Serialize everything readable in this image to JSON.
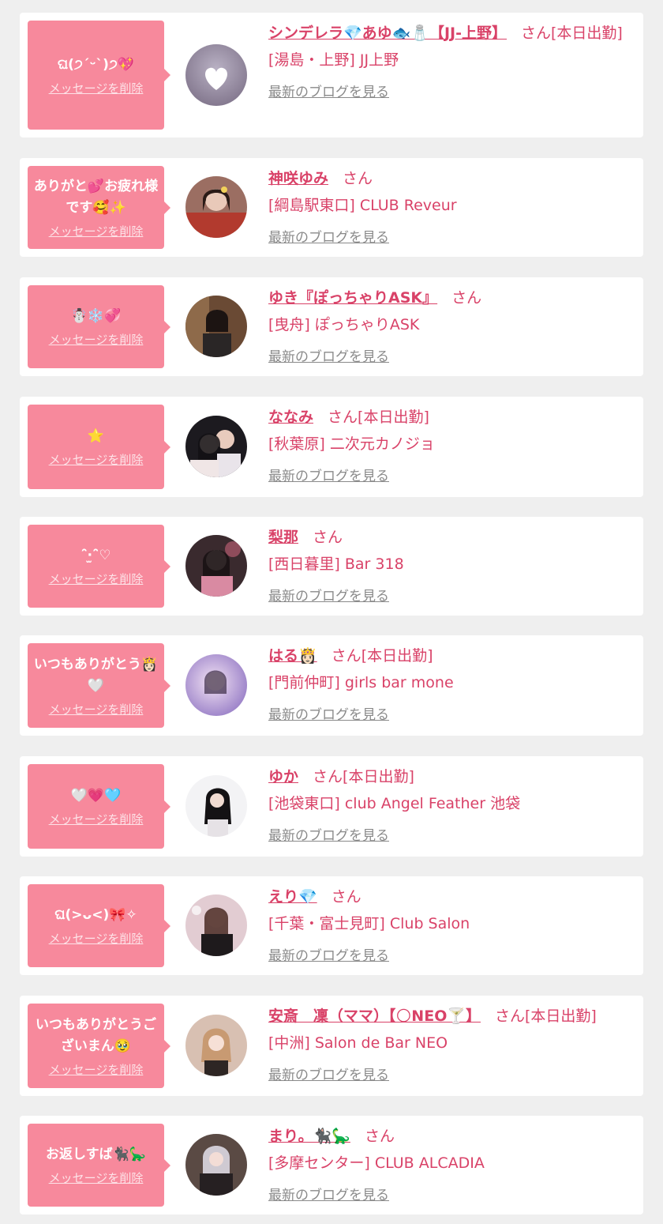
{
  "colors": {
    "accent": "#d94268",
    "bubble": "#f7899c",
    "background": "#efefef",
    "card": "#ffffff",
    "link_gray": "#8a8a8a"
  },
  "common": {
    "delete_label": "メッセージを削除",
    "blog_label": "最新のブログを見る",
    "honorific": "さん"
  },
  "items": [
    {
      "message": "ଘ(੭ˊᵕˋ)੭💖",
      "name": "シンデレラ💎あゆ🐟🧂【JJ-上野】",
      "status": "[本日出勤]",
      "shop": "[湯島・上野] JJ上野",
      "avatar": "heart-placeholder"
    },
    {
      "message": "ありがと💕お疲れ様です🥰✨",
      "name": "神咲ゆみ",
      "status": "",
      "shop": "[綱島駅東口] CLUB Reveur",
      "avatar": "kimono"
    },
    {
      "message": "☃️❄️💞",
      "name": "ゆき『ぽっちゃりASK』",
      "status": "",
      "shop": "[曳舟] ぽっちゃりASK",
      "avatar": "dark-room"
    },
    {
      "message": "⭐️",
      "name": "ななみ",
      "status": "[本日出勤]",
      "shop": "[秋葉原] 二次元カノジョ",
      "avatar": "duo"
    },
    {
      "message": "ˆ̑̑‧̫ˆ̑̑♡",
      "name": "梨那",
      "status": "",
      "shop": "[西日暮里] Bar 318",
      "avatar": "night"
    },
    {
      "message": "いつもありがとう👸🏻🤍",
      "name": "はる👸🏻",
      "status": "[本日出勤]",
      "shop": "[門前仲町] girls bar mone",
      "avatar": "blur-purple"
    },
    {
      "message": "🤍💗🩵",
      "name": "ゆか",
      "status": "[本日出勤]",
      "shop": "[池袋東口] club Angel Feather 池袋",
      "avatar": "white-bg"
    },
    {
      "message": "ଘ(>ᴗ<)🎀✧",
      "name": "えり💎",
      "status": "",
      "shop": "[千葉・富士見町] Club Salon",
      "avatar": "bright"
    },
    {
      "message": "いつもありがとうございまん🥹",
      "name": "安斎　凜（ママ）【🌕NEO🍸】",
      "status": "[本日出勤]",
      "shop": "[中洲] Salon de Bar NEO",
      "avatar": "blonde"
    },
    {
      "message": "お返しすば🐈‍⬛🦕",
      "name": "まり。🐈‍⬛🦕",
      "status": "",
      "shop": "[多摩センター] CLUB ALCADIA",
      "avatar": "silver"
    }
  ]
}
